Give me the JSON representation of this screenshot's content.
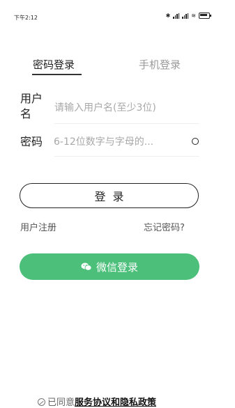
{
  "status_bar": {
    "time": "下午2:12",
    "icons": [
      "bluetooth-icon",
      "signal-icon",
      "signal-icon",
      "wifi-icon",
      "battery-icon"
    ]
  },
  "tabs": [
    {
      "label": "密码登录",
      "active": true
    },
    {
      "label": "手机登录",
      "active": false
    }
  ],
  "form": {
    "username_label": "用户名",
    "username_placeholder": "请输入用户名(至少3位)",
    "username_value": "",
    "password_label": "密码",
    "password_placeholder": "6-12位数字与字母的...",
    "password_value": ""
  },
  "buttons": {
    "login": "登录",
    "wechat_login": "微信登录"
  },
  "links": {
    "register": "用户注册",
    "forgot_password": "忘记密码?"
  },
  "agreement": {
    "prefix": "已同意",
    "link": "服务协议和隐私政策"
  },
  "colors": {
    "wechat_green": "#4cc07a",
    "text": "#222222",
    "placeholder": "#a8a8a8"
  }
}
